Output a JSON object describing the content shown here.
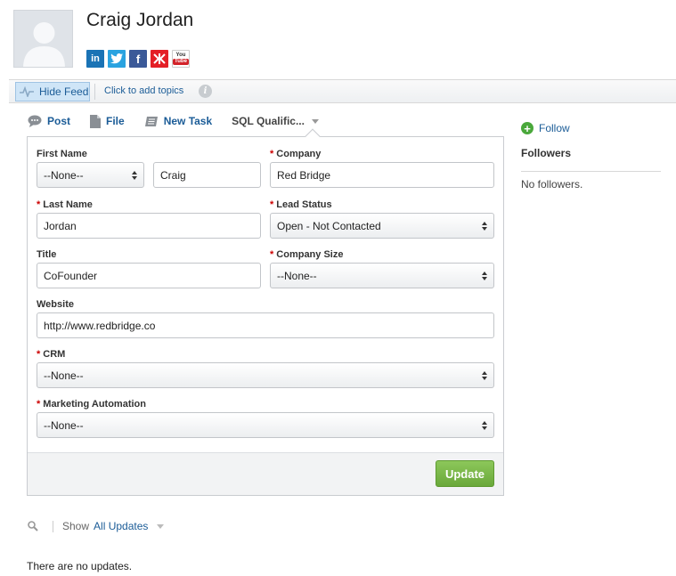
{
  "profile": {
    "name": "Craig Jordan",
    "socials": [
      {
        "icon": "linkedin-icon",
        "label": "in"
      },
      {
        "icon": "twitter-icon",
        "label": "t"
      },
      {
        "icon": "facebook-icon",
        "label": "f"
      },
      {
        "icon": "klout-icon",
        "label": "K"
      },
      {
        "icon": "youtube-icon",
        "label": "YouTube"
      }
    ]
  },
  "topbar": {
    "hide_feed": "Hide Feed",
    "add_topics": "Click to add topics",
    "info": "i"
  },
  "actions": {
    "post": "Post",
    "file": "File",
    "new_task": "New Task",
    "sql": "SQL Qualific..."
  },
  "form": {
    "first_name_label": "First Name",
    "salutation_value": "--None--",
    "first_name_value": "Craig",
    "company_label": "Company",
    "company_value": "Red Bridge",
    "last_name_label": "Last Name",
    "last_name_value": "Jordan",
    "lead_status_label": "Lead Status",
    "lead_status_value": "Open - Not Contacted",
    "title_label": "Title",
    "title_value": "CoFounder",
    "company_size_label": "Company Size",
    "company_size_value": "--None--",
    "website_label": "Website",
    "website_value": "http://www.redbridge.co",
    "crm_label": "CRM",
    "crm_value": "--None--",
    "marketing_label": "Marketing Automation",
    "marketing_value": "--None--",
    "required_mark": "*",
    "update_label": "Update"
  },
  "sidebar": {
    "follow": "Follow",
    "followers_title": "Followers",
    "no_followers": "No followers."
  },
  "feed": {
    "show_label": "Show",
    "filter_value": "All Updates",
    "empty": "There are no updates."
  },
  "colors": {
    "link": "#1b5c97",
    "required": "#cc0000",
    "update_button": "#76b343"
  }
}
